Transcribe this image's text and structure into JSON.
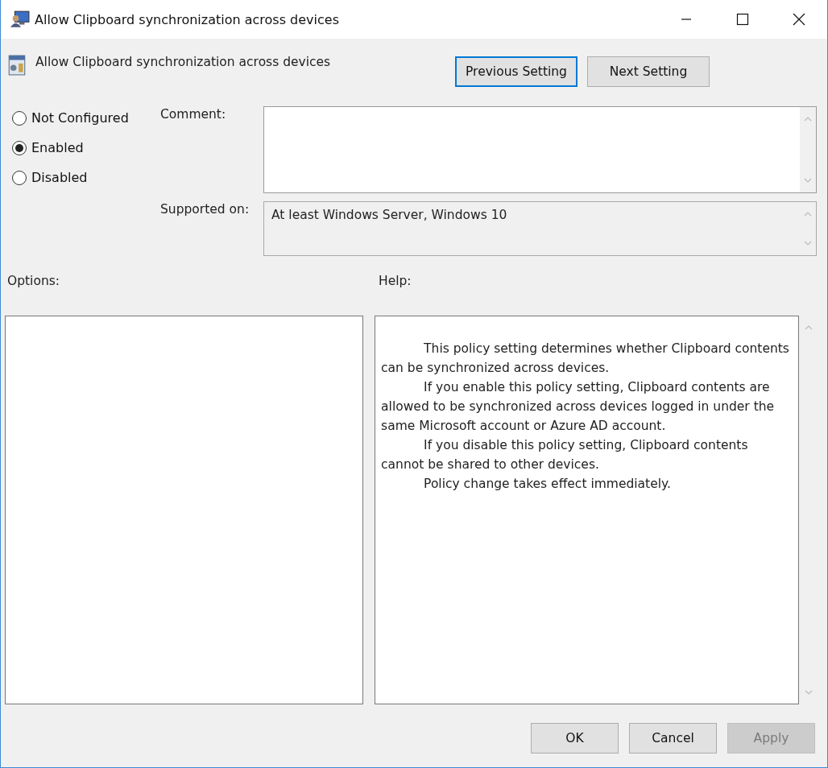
{
  "window": {
    "title": "Allow Clipboard synchronization across devices"
  },
  "header": {
    "title": "Allow Clipboard synchronization across devices"
  },
  "nav_buttons": [
    {
      "label": "Previous Setting",
      "focused": true
    },
    {
      "label": "Next Setting",
      "focused": false
    }
  ],
  "states": [
    {
      "label": "Not Configured",
      "selected": false
    },
    {
      "label": "Enabled",
      "selected": true
    },
    {
      "label": "Disabled",
      "selected": false
    }
  ],
  "comment": {
    "label": "Comment:"
  },
  "supported_on": {
    "label": "Supported on:",
    "value": "At least Windows Server, Windows 10"
  },
  "options": {
    "label": "Options:"
  },
  "help": {
    "label": "Help:",
    "paragraphs": [
      "This policy setting determines whether Clipboard contents can be synchronized across devices.",
      "If you enable this policy setting, Clipboard contents are allowed to be synchronized across devices logged in under the same Microsoft account or Azure AD account.",
      "If you disable this policy setting, Clipboard contents cannot be shared to other devices.",
      "Policy change takes effect immediately."
    ]
  },
  "buttons": [
    {
      "label": "OK",
      "disabled": false
    },
    {
      "label": "Cancel",
      "disabled": false
    },
    {
      "label": "Apply",
      "disabled": true
    }
  ]
}
